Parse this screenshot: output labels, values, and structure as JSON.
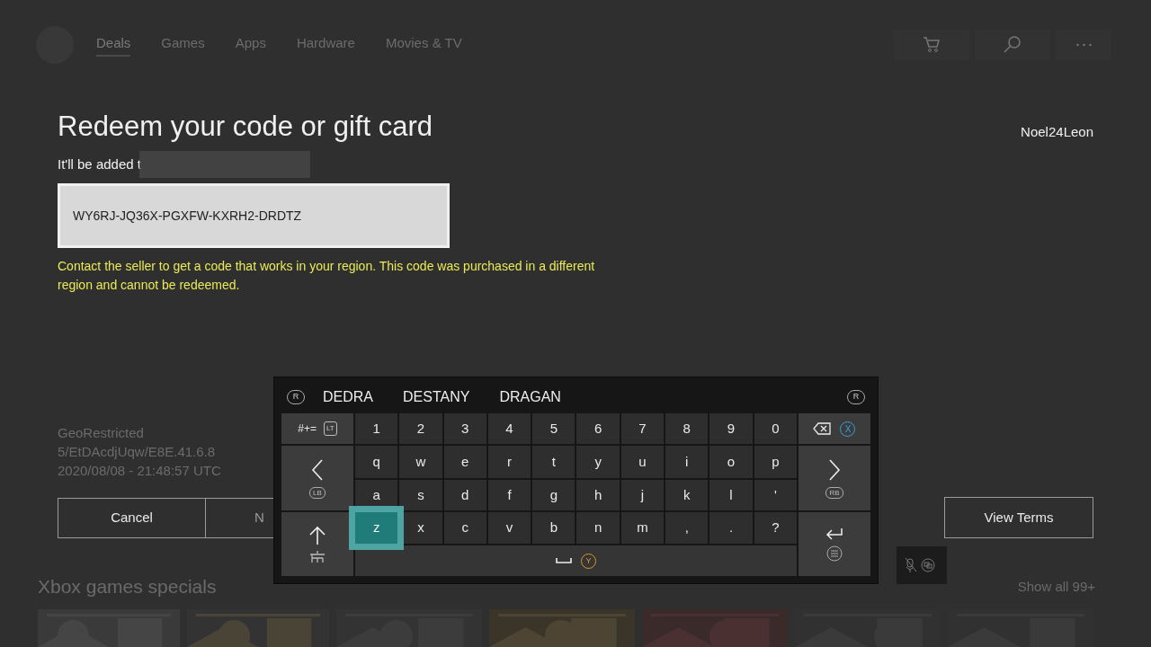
{
  "nav": {
    "items": [
      {
        "label": "Deals",
        "selected": true
      },
      {
        "label": "Games",
        "selected": false
      },
      {
        "label": "Apps",
        "selected": false
      },
      {
        "label": "Hardware",
        "selected": false
      },
      {
        "label": "Movies & TV",
        "selected": false
      }
    ]
  },
  "title": "Redeem your code or gift card",
  "subtitle": "It'll be added t",
  "user": "Noel24Leon",
  "code_field": {
    "value": "WY6RJ-JQ36X-PGXFW-KXRH2-DRDTZ"
  },
  "error": "Contact the seller to get a code that works in your region. This code was purchased in a different region and cannot be redeemed.",
  "info_lines": [
    "GeoRestricted",
    "5/EtDAcdjUqw/E8E.41.6.8",
    "2020/08/08 - 21:48:57 UTC"
  ],
  "buttons": [
    {
      "label": "Cancel"
    },
    {
      "label": "N"
    }
  ],
  "view_terms": {
    "label": "View Terms"
  },
  "keyboard": {
    "prev_hint": "R",
    "next_hint": "R",
    "suggestions": [
      "DEDRA",
      "DESTANY",
      "DRAGAN"
    ],
    "side_keys": [
      {
        "kind": "symbols",
        "label": "#+=",
        "hint": "LT"
      },
      {
        "kind": "backspace",
        "hint": "X"
      },
      {
        "kind": "left",
        "hint": "LB"
      },
      {
        "kind": "right",
        "hint": "RB"
      },
      {
        "kind": "shift"
      },
      {
        "kind": "enter"
      }
    ],
    "rows": [
      [
        {
          "label": "1",
          "selected": false
        },
        {
          "label": "2",
          "selected": false
        },
        {
          "label": "3",
          "selected": false
        },
        {
          "label": "4",
          "selected": false
        },
        {
          "label": "5",
          "selected": false
        },
        {
          "label": "6",
          "selected": false
        },
        {
          "label": "7",
          "selected": false
        },
        {
          "label": "8",
          "selected": false
        },
        {
          "label": "9",
          "selected": false
        },
        {
          "label": "0",
          "selected": false
        }
      ],
      [
        {
          "label": "q",
          "selected": false
        },
        {
          "label": "w",
          "selected": false
        },
        {
          "label": "e",
          "selected": false
        },
        {
          "label": "r",
          "selected": false
        },
        {
          "label": "t",
          "selected": false
        },
        {
          "label": "y",
          "selected": false
        },
        {
          "label": "u",
          "selected": false
        },
        {
          "label": "i",
          "selected": false
        },
        {
          "label": "o",
          "selected": false
        },
        {
          "label": "p",
          "selected": false
        }
      ],
      [
        {
          "label": "a",
          "selected": false
        },
        {
          "label": "s",
          "selected": false
        },
        {
          "label": "d",
          "selected": false
        },
        {
          "label": "f",
          "selected": false
        },
        {
          "label": "g",
          "selected": false
        },
        {
          "label": "h",
          "selected": false
        },
        {
          "label": "j",
          "selected": false
        },
        {
          "label": "k",
          "selected": false
        },
        {
          "label": "l",
          "selected": false
        },
        {
          "label": "'",
          "selected": false
        }
      ],
      [
        {
          "label": "z",
          "selected": true
        },
        {
          "label": "x",
          "selected": false
        },
        {
          "label": "c",
          "selected": false
        },
        {
          "label": "v",
          "selected": false
        },
        {
          "label": "b",
          "selected": false
        },
        {
          "label": "n",
          "selected": false
        },
        {
          "label": "m",
          "selected": false
        },
        {
          "label": ",",
          "selected": false
        },
        {
          "label": ".",
          "selected": false
        },
        {
          "label": "?",
          "selected": false
        }
      ]
    ],
    "space_hint": "Y"
  },
  "section": {
    "title": "Xbox games specials",
    "show_all": "Show all 99+"
  }
}
